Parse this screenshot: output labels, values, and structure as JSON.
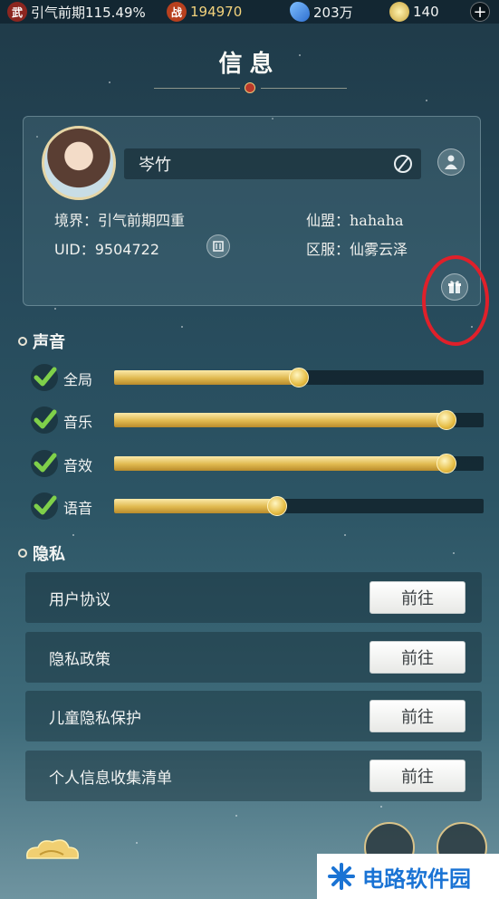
{
  "topbar": {
    "realm_icon": "武",
    "realm_text": "引气前期115.49%",
    "power_icon": "战",
    "power_value": "194970",
    "spirit_value": "203万",
    "jade_value": "140",
    "plus_label": "+"
  },
  "page": {
    "title": "信息"
  },
  "profile": {
    "name": "岑竹",
    "realm_label": "境界：引气前期四重",
    "uid_label": "UID：9504722",
    "alliance_label": "仙盟：hahaha",
    "server_label": "区服：仙雾云泽"
  },
  "sound": {
    "header": "声音",
    "sliders": [
      {
        "label": "全局",
        "level": 0.5,
        "checked": true
      },
      {
        "label": "音乐",
        "level": 0.9,
        "checked": true
      },
      {
        "label": "音效",
        "level": 0.9,
        "checked": true
      },
      {
        "label": "语音",
        "level": 0.44,
        "checked": true
      }
    ]
  },
  "privacy": {
    "header": "隐私",
    "items": [
      {
        "label": "用户协议",
        "button": "前往"
      },
      {
        "label": "隐私政策",
        "button": "前往"
      },
      {
        "label": "儿童隐私保护",
        "button": "前往"
      },
      {
        "label": "个人信息收集清单",
        "button": "前往"
      }
    ]
  },
  "watermark": {
    "text": "电路软件园"
  },
  "colors": {
    "accent_gold": "#e0b94f",
    "highlight_red": "#e0202a",
    "watermark_blue": "#1a73d4"
  }
}
